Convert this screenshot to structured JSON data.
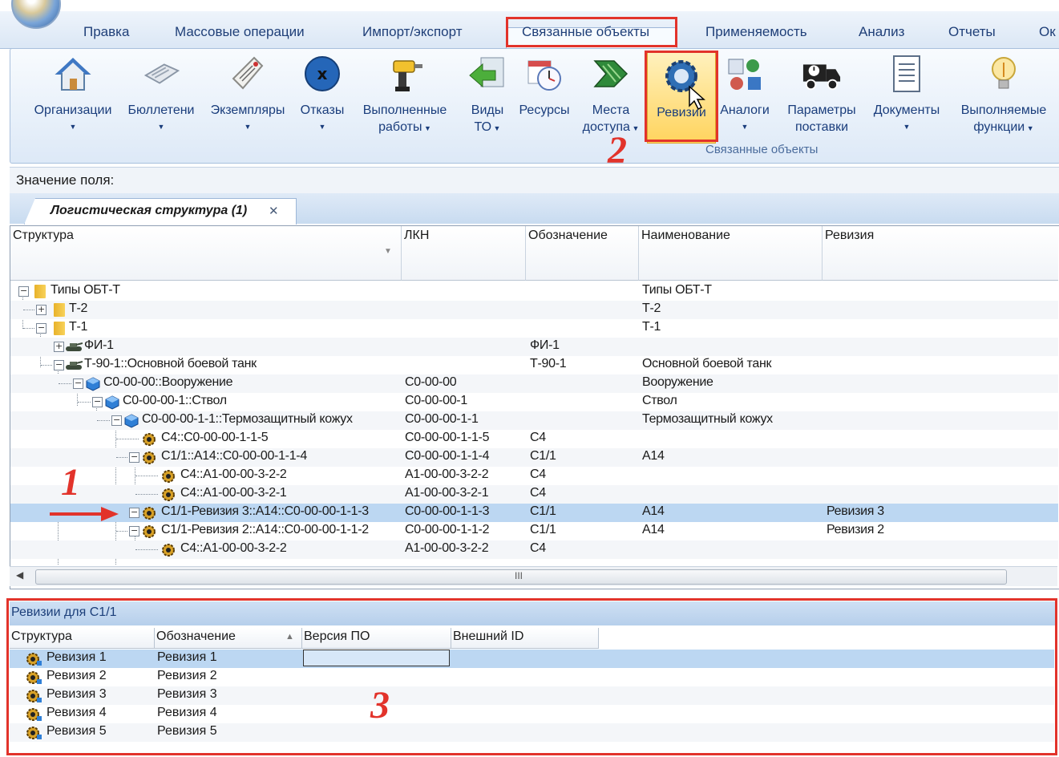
{
  "menu": {
    "tabs": [
      "Правка",
      "Массовые операции",
      "Импорт/экспорт",
      "Связанные объекты",
      "Применяемость",
      "Анализ",
      "Отчеты",
      "Ок"
    ],
    "active": "Связанные объекты"
  },
  "ribbon": {
    "buttons": [
      {
        "l1": "Организации",
        "l2": "",
        "arrow": true
      },
      {
        "l1": "Бюллетени",
        "l2": "",
        "arrow": true
      },
      {
        "l1": "Экземпляры",
        "l2": "",
        "arrow": true
      },
      {
        "l1": "Отказы",
        "l2": "",
        "arrow": true
      },
      {
        "l1": "Выполненные",
        "l2": "работы",
        "arrow": true
      },
      {
        "l1": "Виды",
        "l2": "ТО",
        "arrow": true
      },
      {
        "l1": "Ресурсы",
        "l2": "",
        "arrow": false
      },
      {
        "l1": "Места",
        "l2": "доступа",
        "arrow": true
      },
      {
        "l1": "Ревизии",
        "l2": "",
        "arrow": false
      },
      {
        "l1": "Аналоги",
        "l2": "",
        "arrow": true
      },
      {
        "l1": "Параметры",
        "l2": "поставки",
        "arrow": false
      },
      {
        "l1": "Документы",
        "l2": "",
        "arrow": true
      },
      {
        "l1": "Выполняемые",
        "l2": "функции",
        "arrow": true
      }
    ],
    "group_label": "Связанные объекты"
  },
  "field_bar": {
    "label": "Значение поля:"
  },
  "doc_tab": {
    "title": "Логистическая структура (1)",
    "close": "✕"
  },
  "tree": {
    "headers": [
      "Структура",
      "ЛКН",
      "Обозначение",
      "Наименование",
      "Ревизия"
    ],
    "rows": [
      {
        "struct": "Типы  ОБТ-Т",
        "lkn": "",
        "oboz": "",
        "name": "Типы  ОБТ-Т",
        "rev": ""
      },
      {
        "struct": "Т-2",
        "lkn": "",
        "oboz": "",
        "name": "Т-2",
        "rev": ""
      },
      {
        "struct": "Т-1",
        "lkn": "",
        "oboz": "",
        "name": "Т-1",
        "rev": ""
      },
      {
        "struct": "ФИ-1",
        "lkn": "",
        "oboz": "ФИ-1",
        "name": "",
        "rev": ""
      },
      {
        "struct": "Т-90-1::Основной боевой танк",
        "lkn": "",
        "oboz": "Т-90-1",
        "name": "Основной боевой танк",
        "rev": ""
      },
      {
        "struct": "С0-00-00::Вооружение",
        "lkn": "С0-00-00",
        "oboz": "",
        "name": "Вооружение",
        "rev": ""
      },
      {
        "struct": "С0-00-00-1::Ствол",
        "lkn": "С0-00-00-1",
        "oboz": "",
        "name": "Ствол",
        "rev": ""
      },
      {
        "struct": "С0-00-00-1-1::Термозащитный кожух",
        "lkn": "С0-00-00-1-1",
        "oboz": "",
        "name": "Термозащитный кожух",
        "rev": ""
      },
      {
        "struct": "С4::С0-00-00-1-1-5",
        "lkn": "С0-00-00-1-1-5",
        "oboz": "С4",
        "name": "",
        "rev": ""
      },
      {
        "struct": "С1/1::А14::С0-00-00-1-1-4",
        "lkn": "С0-00-00-1-1-4",
        "oboz": "С1/1",
        "name": "А14",
        "rev": ""
      },
      {
        "struct": "С4::А1-00-00-3-2-2",
        "lkn": "А1-00-00-3-2-2",
        "oboz": "С4",
        "name": "",
        "rev": ""
      },
      {
        "struct": "С4::А1-00-00-3-2-1",
        "lkn": "А1-00-00-3-2-1",
        "oboz": "С4",
        "name": "",
        "rev": ""
      },
      {
        "struct": "С1/1-Ревизия 3::А14::С0-00-00-1-1-3",
        "lkn": "С0-00-00-1-1-3",
        "oboz": "С1/1",
        "name": "А14",
        "rev": "Ревизия 3"
      },
      {
        "struct": "С1/1-Ревизия 2::А14::С0-00-00-1-1-2",
        "lkn": "С0-00-00-1-1-2",
        "oboz": "С1/1",
        "name": "А14",
        "rev": "Ревизия 2"
      },
      {
        "struct": "С4::А1-00-00-3-2-2",
        "lkn": "А1-00-00-3-2-2",
        "oboz": "С4",
        "name": "",
        "rev": ""
      }
    ],
    "scroll_grip": "III"
  },
  "bottom": {
    "title": "Ревизии для С1/1",
    "headers": [
      "Структура",
      "Обозначение",
      "Версия ПО",
      "Внешний ID"
    ],
    "rows": [
      {
        "struct": "Ревизия 1",
        "oboz": "Ревизия 1"
      },
      {
        "struct": "Ревизия 2",
        "oboz": "Ревизия 2"
      },
      {
        "struct": "Ревизия 3",
        "oboz": "Ревизия 3"
      },
      {
        "struct": "Ревизия 4",
        "oboz": "Ревизия 4"
      },
      {
        "struct": "Ревизия 5",
        "oboz": "Ревизия 5"
      }
    ]
  },
  "annotations": {
    "n1": "1",
    "n2": "2",
    "n3": "3"
  },
  "colors": {
    "annotation": "#e2332b",
    "selection": "#bcd7f2",
    "ribbon_text": "#1a3d7c"
  }
}
